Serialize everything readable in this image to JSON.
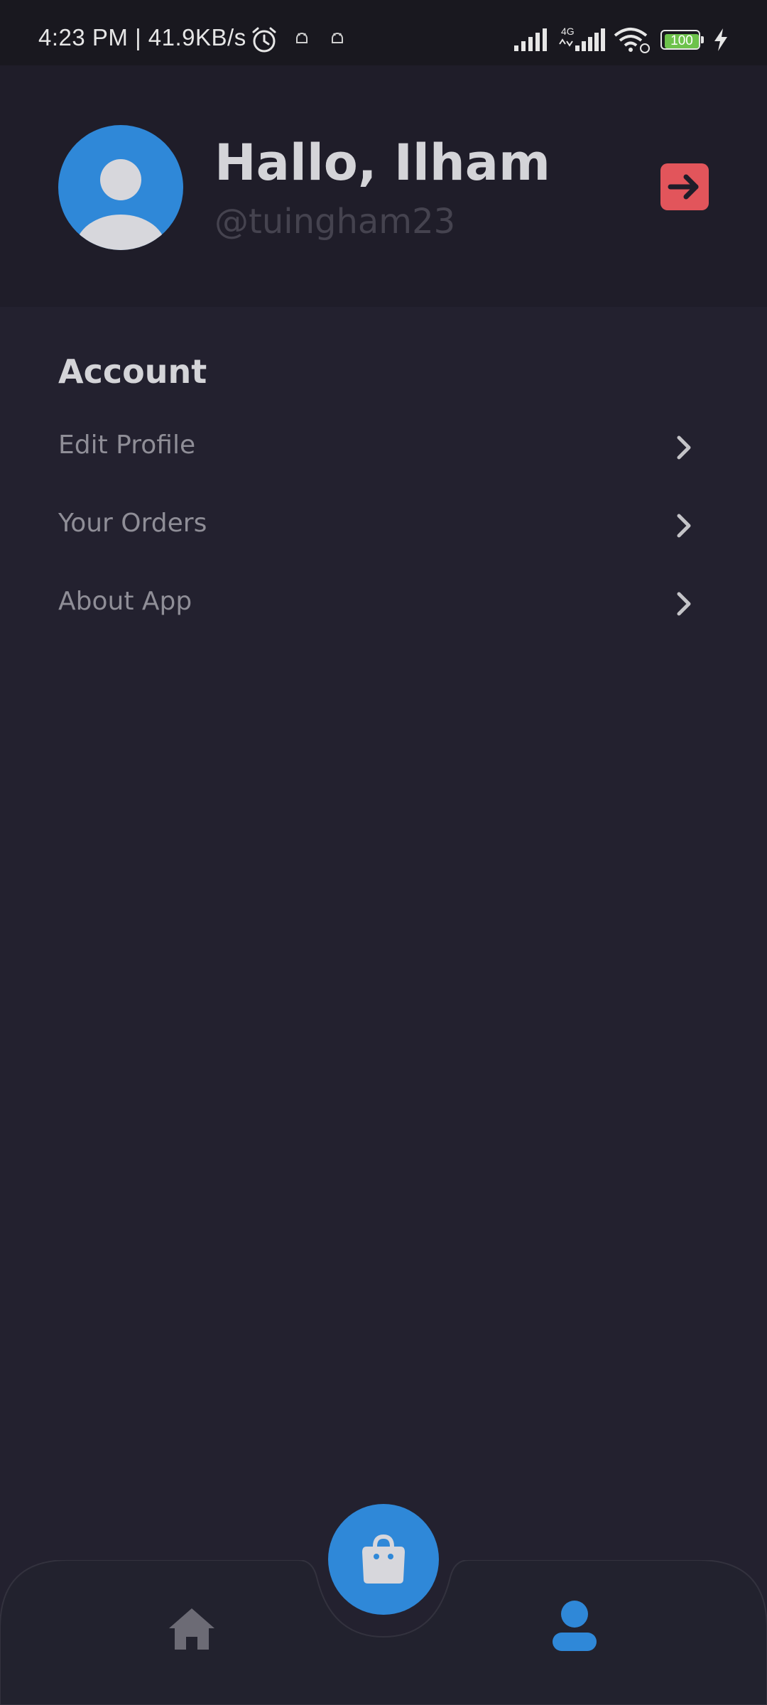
{
  "status_bar": {
    "time_speed": "4:23 PM | 41.9KB/s",
    "network_type": "4G",
    "battery_level": "100",
    "icons": [
      "alarm-icon",
      "android-icon",
      "android-icon",
      "signal-icon",
      "signal-icon",
      "wifi-icon",
      "battery-icon",
      "charging-bolt-icon"
    ]
  },
  "header": {
    "greeting": "Hallo, Ilham",
    "username": "@tuingham23",
    "avatar_icon": "person-avatar-icon",
    "logout_icon": "logout-arrow-icon"
  },
  "account": {
    "title": "Account",
    "items": [
      {
        "label": "Edit Profile",
        "icon": "chevron-right-icon"
      },
      {
        "label": "Your Orders",
        "icon": "chevron-right-icon"
      },
      {
        "label": "About App",
        "icon": "chevron-right-icon"
      }
    ]
  },
  "bottom_nav": {
    "items": [
      {
        "name": "home",
        "icon": "home-icon",
        "active": false
      },
      {
        "name": "cart",
        "icon": "shopping-bag-icon",
        "active": false
      },
      {
        "name": "profile",
        "icon": "profile-icon",
        "active": true
      }
    ]
  },
  "colors": {
    "background": "#23212f",
    "header_background": "#1f1d29",
    "accent": "#2f88d8",
    "logout": "#e2555b",
    "text_primary": "#d4d4d8",
    "text_secondary": "#8f8e97",
    "inactive_icon": "#6c6b75"
  }
}
